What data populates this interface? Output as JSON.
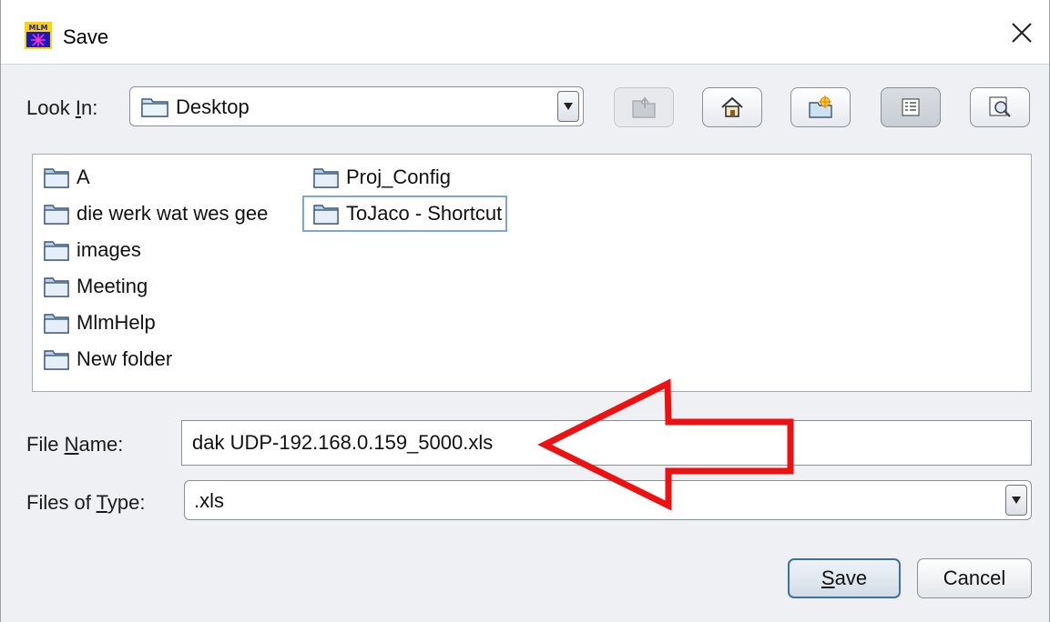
{
  "window": {
    "title": "Save",
    "close_label": "×",
    "app_icon": "mlm-app-icon"
  },
  "lookin": {
    "label_pre": "Look ",
    "label_mn": "I",
    "label_post": "n:",
    "value": "Desktop"
  },
  "toolbar": {
    "buttons": [
      {
        "name": "up-one-level",
        "icon": "folder-up-icon",
        "enabled": false
      },
      {
        "name": "home",
        "icon": "home-icon",
        "enabled": true
      },
      {
        "name": "new-folder",
        "icon": "new-folder-icon",
        "enabled": true
      },
      {
        "name": "list-view",
        "icon": "list-view-icon",
        "enabled": true,
        "selected": true
      },
      {
        "name": "details-view",
        "icon": "details-view-icon",
        "enabled": true
      }
    ]
  },
  "files": {
    "column1": [
      "A",
      "die werk wat wes gee",
      "images",
      "Meeting",
      "MlmHelp",
      "New folder"
    ],
    "column2": [
      "Proj_Config",
      "ToJaco - Shortcut"
    ],
    "focused_item": "ToJaco - Shortcut"
  },
  "filename": {
    "label_pre": "File ",
    "label_mn": "N",
    "label_post": "ame:",
    "value": "dak UDP-192.168.0.159_5000.xls"
  },
  "filetype": {
    "label_pre": "Files of ",
    "label_mn": "T",
    "label_post": "ype:",
    "value": ".xls"
  },
  "actions": {
    "save_mn": "S",
    "save_rest": "ave",
    "cancel": "Cancel"
  },
  "annotation": {
    "shape": "red-arrow-pointing-left",
    "color": "#ee1111"
  },
  "colors": {
    "window_bg": "#eef0f3",
    "focus_border": "#3d6fa9",
    "folder_icon": "#6f8fb0"
  }
}
